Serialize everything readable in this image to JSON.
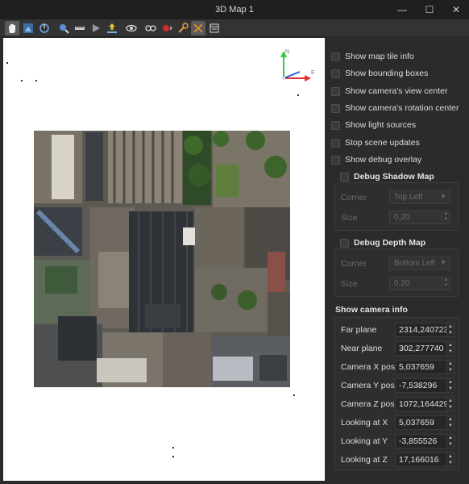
{
  "window": {
    "title": "3D Map 1",
    "minimize": "—",
    "maximize": "☐",
    "close": "✕"
  },
  "toolbar": {
    "items": [
      {
        "name": "pan-hand-icon",
        "active": true
      },
      {
        "name": "zoom-area-icon",
        "active": false
      },
      {
        "name": "rotate-icon",
        "active": false
      },
      {
        "name": "identify-icon",
        "active": false
      },
      {
        "name": "measure-icon",
        "active": false
      },
      {
        "name": "animation-play-icon",
        "active": false
      },
      {
        "name": "export-icon",
        "active": false
      },
      {
        "name": "view-options-icon",
        "active": false
      },
      {
        "name": "camera-options-icon",
        "active": false
      },
      {
        "name": "effects-icon",
        "active": false
      },
      {
        "name": "configure-icon",
        "active": false
      },
      {
        "name": "map-theme-icon",
        "active": true
      },
      {
        "name": "menu-icon",
        "active": false
      }
    ]
  },
  "panel": {
    "checkboxes": [
      {
        "label": "Show map tile info",
        "checked": false
      },
      {
        "label": "Show bounding boxes",
        "checked": false
      },
      {
        "label": "Show camera's view center",
        "checked": false
      },
      {
        "label": "Show camera's rotation center",
        "checked": false
      },
      {
        "label": "Show light sources",
        "checked": false
      },
      {
        "label": "Stop scene updates",
        "checked": false
      },
      {
        "label": "Show debug overlay",
        "checked": false
      }
    ],
    "shadow": {
      "title": "Debug Shadow Map",
      "corner_label": "Corner",
      "corner_value": "Top Left",
      "size_label": "Size",
      "size_value": "0,20"
    },
    "depth": {
      "title": "Debug Depth Map",
      "corner_label": "Corner",
      "corner_value": "Bottom Left",
      "size_label": "Size",
      "size_value": "0,20"
    },
    "camera": {
      "title": "Show camera info",
      "rows": [
        {
          "label": "Far plane",
          "value": "2314,240723"
        },
        {
          "label": "Near plane",
          "value": "302,277740"
        },
        {
          "label": "Camera X pos",
          "value": "5,037659"
        },
        {
          "label": "Camera Y pos",
          "value": "-7,538296"
        },
        {
          "label": "Camera Z pos",
          "value": "1072,164429"
        },
        {
          "label": "Looking at X",
          "value": "5,037659"
        },
        {
          "label": "Looking at Y",
          "value": "-3,855526"
        },
        {
          "label": "Looking at Z",
          "value": "17,166016"
        }
      ]
    }
  },
  "axes": {
    "north_label": "N",
    "east_label": "E",
    "colors": {
      "up": "#2ecc40",
      "east": "#e03030",
      "north": "#2060e0"
    }
  }
}
